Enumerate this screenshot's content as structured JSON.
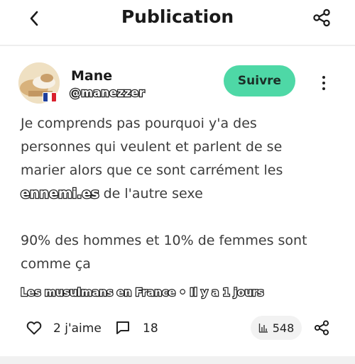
{
  "header": {
    "title": "Publication",
    "back_icon": "chevron-left-icon",
    "share_icon": "share-icon"
  },
  "author": {
    "name": "Mane",
    "handle": "@manezzer",
    "country_flag": "french-flag-icon",
    "follow_label": "Suivre",
    "more_icon": "more-vertical-icon"
  },
  "post": {
    "lines": [
      "Je comprends pas pourquoi y'a des",
      "personnes qui veulent et parlent de se",
      "marier alors que ce sont carrément les"
    ],
    "sticker_word": "ennemi.es",
    "line4_rest": " de l'autre sexe",
    "para2_line1": "90% des hommes et 10% de femmes sont",
    "para2_line2": "comme ça"
  },
  "meta": {
    "community": "Les musulmans en France",
    "separator": " • ",
    "time": "Il y a 1 jours"
  },
  "actions": {
    "likes_label": "2 j'aime",
    "comments_count": "18",
    "views_count": "548",
    "like_icon": "heart-icon",
    "comment_icon": "comment-icon",
    "views_icon": "bar-chart-icon",
    "share_icon": "share-icon"
  },
  "colors": {
    "follow_button": "#4ed8a6",
    "text": "#3c3c3c",
    "views_pill": "#f2f2f2"
  }
}
